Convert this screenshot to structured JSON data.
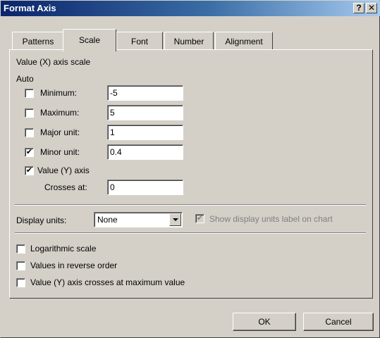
{
  "window": {
    "title": "Format Axis",
    "help_glyph": "?",
    "close_glyph": "✕"
  },
  "tabs": [
    {
      "label": "Patterns",
      "active": false
    },
    {
      "label": "Scale",
      "active": true
    },
    {
      "label": "Font",
      "active": false
    },
    {
      "label": "Number",
      "active": false
    },
    {
      "label": "Alignment",
      "active": false
    }
  ],
  "scale": {
    "heading": "Value (X) axis scale",
    "auto_label": "Auto",
    "minimum": {
      "label": "Minimum:",
      "checked": false,
      "value": "-5"
    },
    "maximum": {
      "label": "Maximum:",
      "checked": false,
      "value": "5"
    },
    "major_unit": {
      "label": "Major unit:",
      "checked": false,
      "value": "1"
    },
    "minor_unit": {
      "label": "Minor unit:",
      "checked": true,
      "value": "0.4"
    },
    "value_axis": {
      "label": "Value (Y) axis",
      "checked": true
    },
    "crosses_at": {
      "label": "Crosses at:",
      "value": "0"
    }
  },
  "display_units": {
    "label": "Display units:",
    "selected": "None",
    "show_label": {
      "label": "Show display units label on chart",
      "checked": true,
      "disabled": true
    }
  },
  "options": {
    "logarithmic": {
      "label": "Logarithmic scale",
      "checked": false
    },
    "reverse": {
      "label": "Values in reverse order",
      "checked": false
    },
    "crosses_max": {
      "label": "Value (Y) axis crosses at maximum value",
      "checked": false
    }
  },
  "buttons": {
    "ok": "OK",
    "cancel": "Cancel"
  },
  "check_glyph": "✔"
}
